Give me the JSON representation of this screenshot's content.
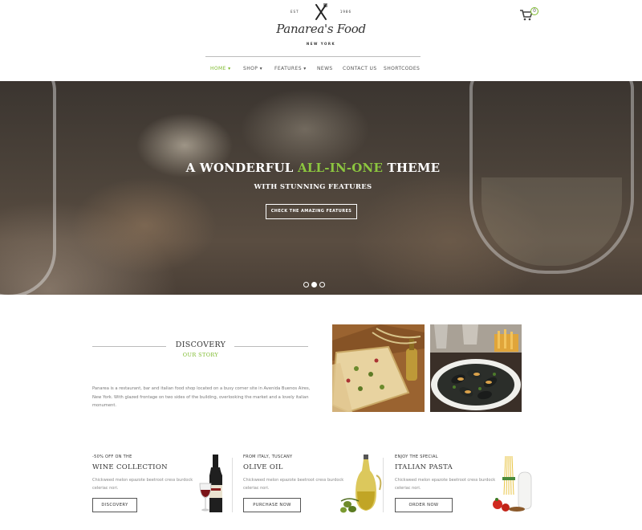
{
  "brand": {
    "est": "EST",
    "year": "1986",
    "name": "Panarea's Food",
    "city": "NEW YORK"
  },
  "cart": {
    "count": "0",
    "icon": "cart-icon"
  },
  "nav": {
    "items": [
      {
        "label": "HOME",
        "has_dropdown": true,
        "active": true
      },
      {
        "label": "SHOP",
        "has_dropdown": true,
        "active": false
      },
      {
        "label": "FEATURES",
        "has_dropdown": true,
        "active": false
      },
      {
        "label": "NEWS",
        "has_dropdown": false,
        "active": false
      },
      {
        "label": "CONTACT US",
        "has_dropdown": false,
        "active": false
      },
      {
        "label": "SHORTCODES",
        "has_dropdown": false,
        "active": false
      }
    ]
  },
  "hero": {
    "title_before": "A WONDERFUL ",
    "title_accent": "ALL-IN-ONE",
    "title_after": " THEME",
    "subtitle": "WITH STUNNING FEATURES",
    "button": "CHECK THE AMAZING FEATURES",
    "slides": 3,
    "active_slide": 2
  },
  "discovery": {
    "title": "DISCOVERY",
    "subtitle": "OUR STORY",
    "text": "Panarea is a restaurant, bar and italian food shop located on a busy corner site in Avenida Buenos Aires, New York. With glazed frontage on two sides of the building, overlooking the market and a lovely italian monument."
  },
  "promos": [
    {
      "kicker": "-50% OFF ON THE",
      "title": "WINE COLLECTION",
      "text": "Chickweed melon epazote beetroot cress burdock celeriac nori.",
      "button": "DISCOVERY"
    },
    {
      "kicker": "FROM ITALY, TUSCANY",
      "title": "OLIVE OIL",
      "text": "Chickweed melon epazote beetroot cress burdock celeriac nori.",
      "button": "PURCHASE NOW"
    },
    {
      "kicker": "ENJOY THE SPECIAL",
      "title": "ITALIAN PASTA",
      "text": "Chickweed melon epazote beetroot cress burdock celeriac nori.",
      "button": "ORDER NOW"
    }
  ],
  "colors": {
    "accent": "#7cba2b",
    "text": "#333333"
  }
}
